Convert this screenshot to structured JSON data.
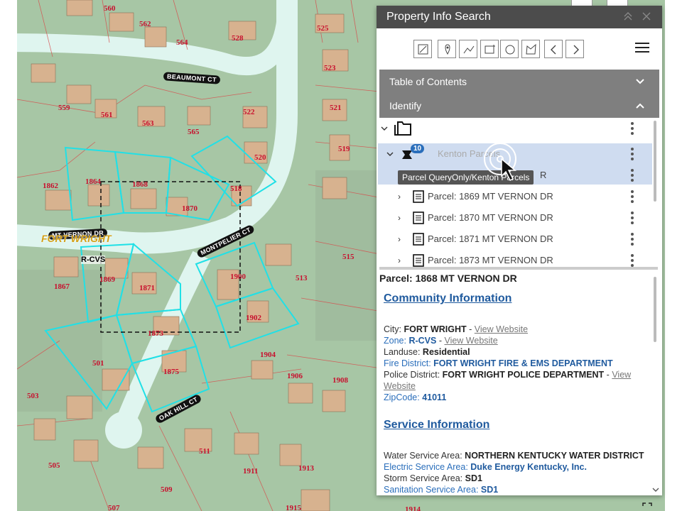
{
  "panel": {
    "title": "Property Info Search",
    "toolbar_icons": [
      "select-icon",
      "point-icon",
      "polyline-icon",
      "rectangle-icon",
      "circle-icon",
      "freehand-icon",
      "back-icon",
      "forward-icon"
    ],
    "sections": [
      {
        "label": "Table of Contents",
        "state": "collapsed"
      },
      {
        "label": "Identify",
        "state": "expanded"
      }
    ],
    "tree": {
      "layer_label": "Kenton Parcels",
      "layer_badge": "10",
      "tooltip": "Parcel QueryOnly/Kenton Parcels",
      "partial_item": "R",
      "items": [
        "Parcel: 1869 MT VERNON DR",
        "Parcel: 1870 MT VERNON DR",
        "Parcel: 1871 MT VERNON DR",
        "Parcel: 1873 MT VERNON DR"
      ]
    },
    "details": {
      "parcel_title": "Parcel: 1868 MT VERNON DR",
      "community_heading": "Community Information",
      "city_label": "City: ",
      "city_value": "FORT WRIGHT",
      "city_link": "View Website",
      "zone_label": "Zone: ",
      "zone_value": "R-CVS",
      "zone_link": "View Website",
      "landuse_label": "Landuse: ",
      "landuse_value": "Residential",
      "fire_label": "Fire District: ",
      "fire_value": "FORT WRIGHT FIRE & EMS DEPARTMENT",
      "police_label": "Police District: ",
      "police_value": "FORT WRIGHT POLICE DEPARTMENT",
      "police_link": "View Website",
      "zip_label": "ZipCode: ",
      "zip_value": "41011",
      "service_heading": "Service Information",
      "water_label": "Water Service Area: ",
      "water_value": "NORTHERN KENTUCKY WATER DISTRICT",
      "electric_label": "Electric Service Area: ",
      "electric_value": "Duke Energy Kentucky, Inc.",
      "storm_label": "Storm Service Area: ",
      "storm_value": "SD1",
      "sanitation_label": "Sanitation Service Area: ",
      "sanitation_value": "SD1"
    }
  },
  "map": {
    "lot_numbers": [
      "560",
      "562",
      "564",
      "528",
      "525",
      "523",
      "521",
      "522",
      "520",
      "519",
      "565",
      "563",
      "561",
      "559",
      "1862",
      "1864",
      "1868",
      "518",
      "1870",
      "1867",
      "1869",
      "1871",
      "1900",
      "513",
      "515",
      "1902",
      "1873",
      "1875",
      "1904",
      "501",
      "503",
      "1906",
      "1908",
      "505",
      "511",
      "1911",
      "1913",
      "509",
      "507",
      "1915",
      "1914"
    ],
    "roads": [
      "BEAUMONT CT",
      "MT VERNON DR",
      "MONTPELIER CT",
      "OAK HILL CT"
    ],
    "city_label": "FORT WRIGHT",
    "zone_label": "R-CVS"
  },
  "colors": {
    "header": "#4c4c4c",
    "section": "#7f7f7f",
    "link": "#1f5a9e",
    "parcel_outline": "#21e0e6"
  }
}
